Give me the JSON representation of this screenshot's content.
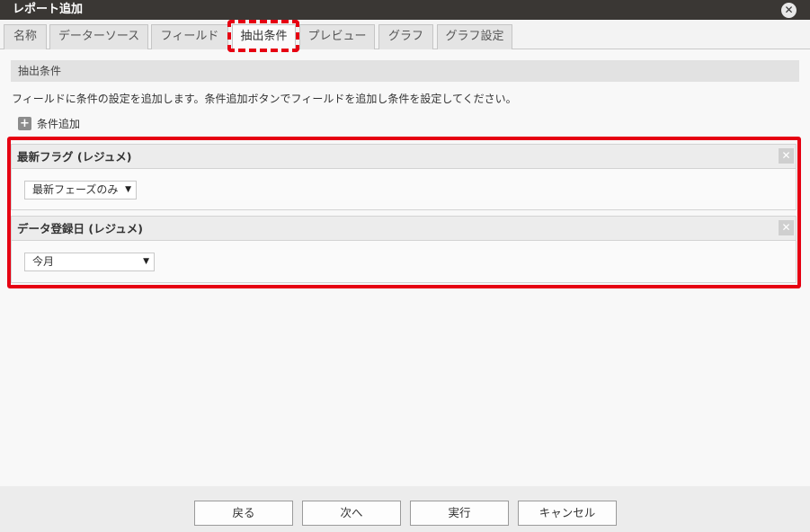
{
  "window": {
    "title": "レポート追加"
  },
  "tabs": [
    {
      "label": "名称"
    },
    {
      "label": "データーソース"
    },
    {
      "label": "フィールド"
    },
    {
      "label": "抽出条件"
    },
    {
      "label": "プレビュー"
    },
    {
      "label": "グラフ"
    },
    {
      "label": "グラフ設定"
    }
  ],
  "active_tab": "抽出条件",
  "section": {
    "title": "抽出条件",
    "description": "フィールドに条件の設定を追加します。条件追加ボタンでフィールドを追加し条件を設定してください。",
    "add_button_label": "条件追加"
  },
  "conditions": [
    {
      "title": "最新フラグ (レジュメ)",
      "value": "最新フェーズのみ"
    },
    {
      "title": "データ登録日 (レジュメ)",
      "value": "今月"
    }
  ],
  "icons": {
    "close": "close-icon",
    "remove": "remove-condition-icon",
    "add": "plus-icon",
    "dropdown": "dropdown-arrow-icon"
  },
  "colors": {
    "highlight": "#e60012",
    "titlebar": "#3a3734"
  },
  "footer": {
    "back_label": "戻る",
    "next_label": "次へ",
    "run_label": "実行",
    "cancel_label": "キャンセル"
  }
}
